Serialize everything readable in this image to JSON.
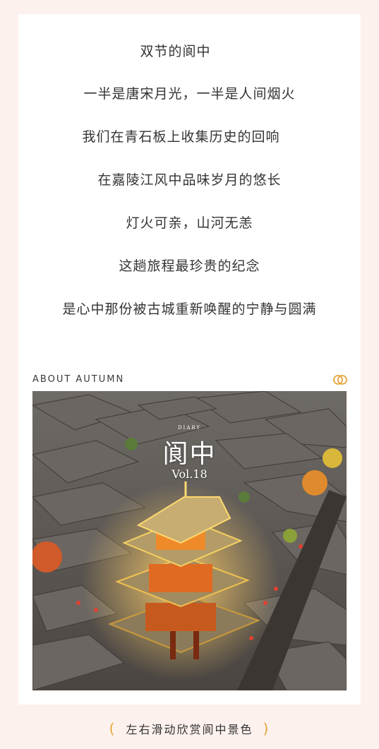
{
  "poem": {
    "lines": [
      "双节的阆中",
      "一半是唐宋月光，一半是人间烟火",
      "我们在青石板上收集历史的回响",
      "在嘉陵江风中品味岁月的悠长",
      "灯火可亲，山河无恙",
      "这趟旅程最珍贵的纪念",
      "是心中那份被古城重新唤醒的宁静与圆满"
    ]
  },
  "section": {
    "label": "ABOUT AUTUMN",
    "icon": "rings-icon"
  },
  "photo": {
    "overlay_small": "DIARY",
    "overlay_title": "阆中",
    "overlay_vol": "Vol.18"
  },
  "footer": {
    "open_paren": "(",
    "hint": "左右滑动欣赏阆中景色",
    "close_paren": ")"
  },
  "colors": {
    "background": "#fdf1ee",
    "accent": "#e6a53a",
    "text": "#333333"
  }
}
